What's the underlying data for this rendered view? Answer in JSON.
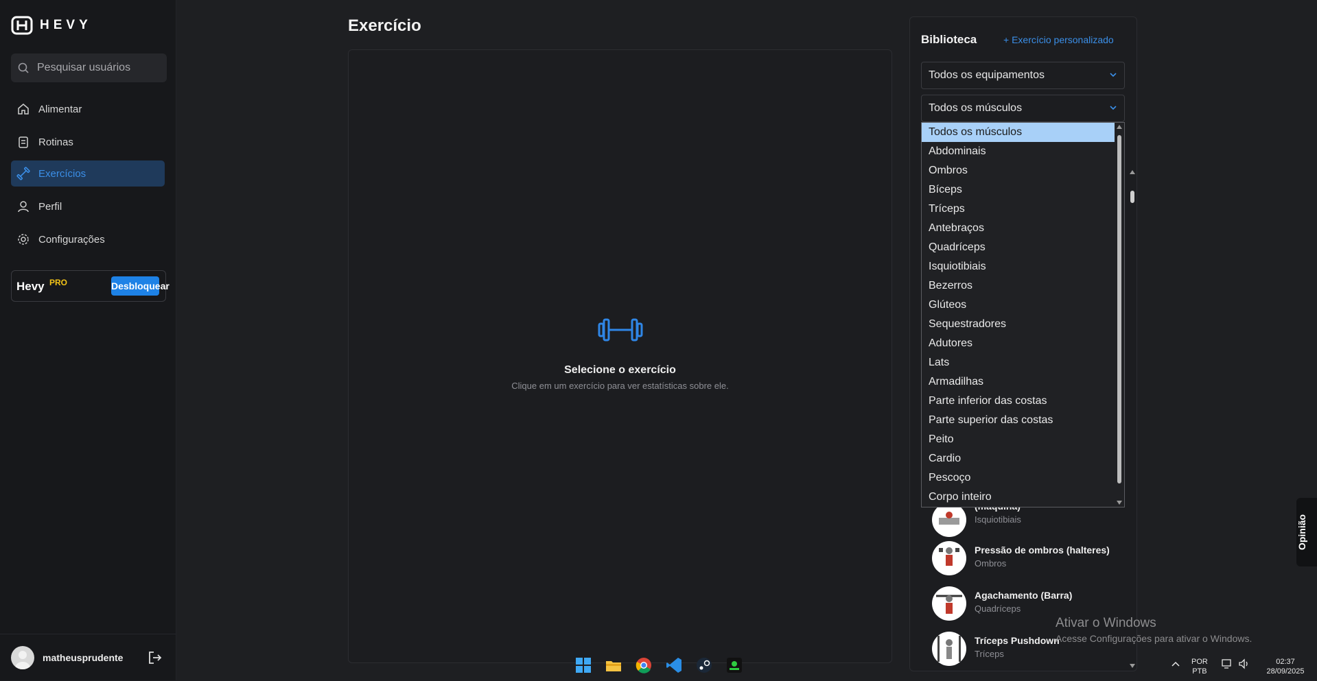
{
  "app": {
    "logo_text": "HEVY"
  },
  "sidebar": {
    "search_placeholder": "Pesquisar usuários",
    "items": [
      {
        "label": "Alimentar",
        "icon": "home-icon"
      },
      {
        "label": "Rotinas",
        "icon": "clipboard-icon"
      },
      {
        "label": "Exercícios",
        "icon": "dumbbell-icon",
        "active": true
      },
      {
        "label": "Perfil",
        "icon": "user-icon"
      },
      {
        "label": "Configurações",
        "icon": "gear-icon"
      }
    ],
    "pro": {
      "name": "Hevy",
      "tag": "PRO",
      "button": "Desbloquear"
    },
    "user": {
      "username": "matheusprudente"
    }
  },
  "main": {
    "title": "Exercício",
    "empty_title": "Selecione o exercício",
    "empty_subtitle": "Clique em um exercício para ver estatísticas sobre ele."
  },
  "library": {
    "title": "Biblioteca",
    "custom_link": "+ Exercício personalizado",
    "equipment_select": "Todos os equipamentos",
    "muscle_select": "Todos os músculos",
    "muscle_options": [
      "Todos os músculos",
      "Abdominais",
      "Ombros",
      "Bíceps",
      "Tríceps",
      "Antebraços",
      "Quadríceps",
      "Isquiotibiais",
      "Bezerros",
      "Glúteos",
      "Sequestradores",
      "Adutores",
      "Lats",
      "Armadilhas",
      "Parte inferior das costas",
      "Parte superior das costas",
      "Peito",
      "Cardio",
      "Pescoço",
      "Corpo inteiro"
    ],
    "exercises": [
      {
        "name": "(máquina)",
        "muscle": "Isquiotibiais"
      },
      {
        "name": "Pressão de ombros (halteres)",
        "muscle": "Ombros"
      },
      {
        "name": "Agachamento (Barra)",
        "muscle": "Quadríceps"
      },
      {
        "name": "Tríceps Pushdown",
        "muscle": "Tríceps"
      }
    ]
  },
  "feedback_tab": "Opinião",
  "windows_watermark": {
    "title": "Ativar o Windows",
    "subtitle": "Acesse Configurações para ativar o Windows."
  },
  "taskbar": {
    "lang_top": "POR",
    "lang_bottom": "PTB",
    "time": "02:37",
    "date": "28/09/2025"
  },
  "colors": {
    "accent": "#1e82e6",
    "pro": "#f4c518",
    "background": "#1e1f22"
  }
}
